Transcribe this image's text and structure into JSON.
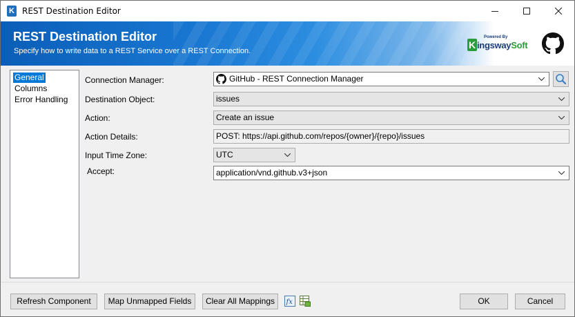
{
  "window": {
    "title": "REST Destination Editor",
    "minimize_glyph": "—",
    "maximize_glyph": "☐",
    "close_glyph": "✕"
  },
  "banner": {
    "title": "REST Destination Editor",
    "subtitle": "Specify how to write data to a REST Service over a REST Connection.",
    "brand_powered": "Powered By",
    "brand_first": "ingsway",
    "brand_second": "Soft",
    "brand_k": "K"
  },
  "nav": {
    "items": [
      {
        "label": "General",
        "selected": true
      },
      {
        "label": "Columns",
        "selected": false
      },
      {
        "label": "Error Handling",
        "selected": false
      }
    ]
  },
  "form": {
    "connection_manager": {
      "label": "Connection Manager:",
      "value": "GitHub - REST Connection Manager"
    },
    "destination_object": {
      "label": "Destination Object:",
      "value": "issues"
    },
    "action": {
      "label": "Action:",
      "value": "Create an issue"
    },
    "action_details": {
      "label": "Action Details:",
      "value": "POST: https://api.github.com/repos/{owner}/{repo}/issues"
    },
    "input_time_zone": {
      "label": "Input Time Zone:",
      "value": "UTC"
    },
    "accept": {
      "label": "Accept:",
      "value": "application/vnd.github.v3+json"
    }
  },
  "footer": {
    "refresh_label": "Refresh Component",
    "map_unmapped_label": "Map Unmapped Fields",
    "clear_all_label": "Clear All Mappings",
    "ok_label": "OK",
    "cancel_label": "Cancel"
  },
  "icons": {
    "app": "kingswaysoft-k-icon",
    "search": "search-icon",
    "fx": "fx-expression-icon",
    "grid": "grid-settings-icon",
    "github": "github-logo-icon"
  },
  "colors": {
    "selection": "#0078d7",
    "banner_start": "#0a5eb8",
    "brand_green": "#2a9d3a",
    "brand_navy": "#1c3e78"
  }
}
